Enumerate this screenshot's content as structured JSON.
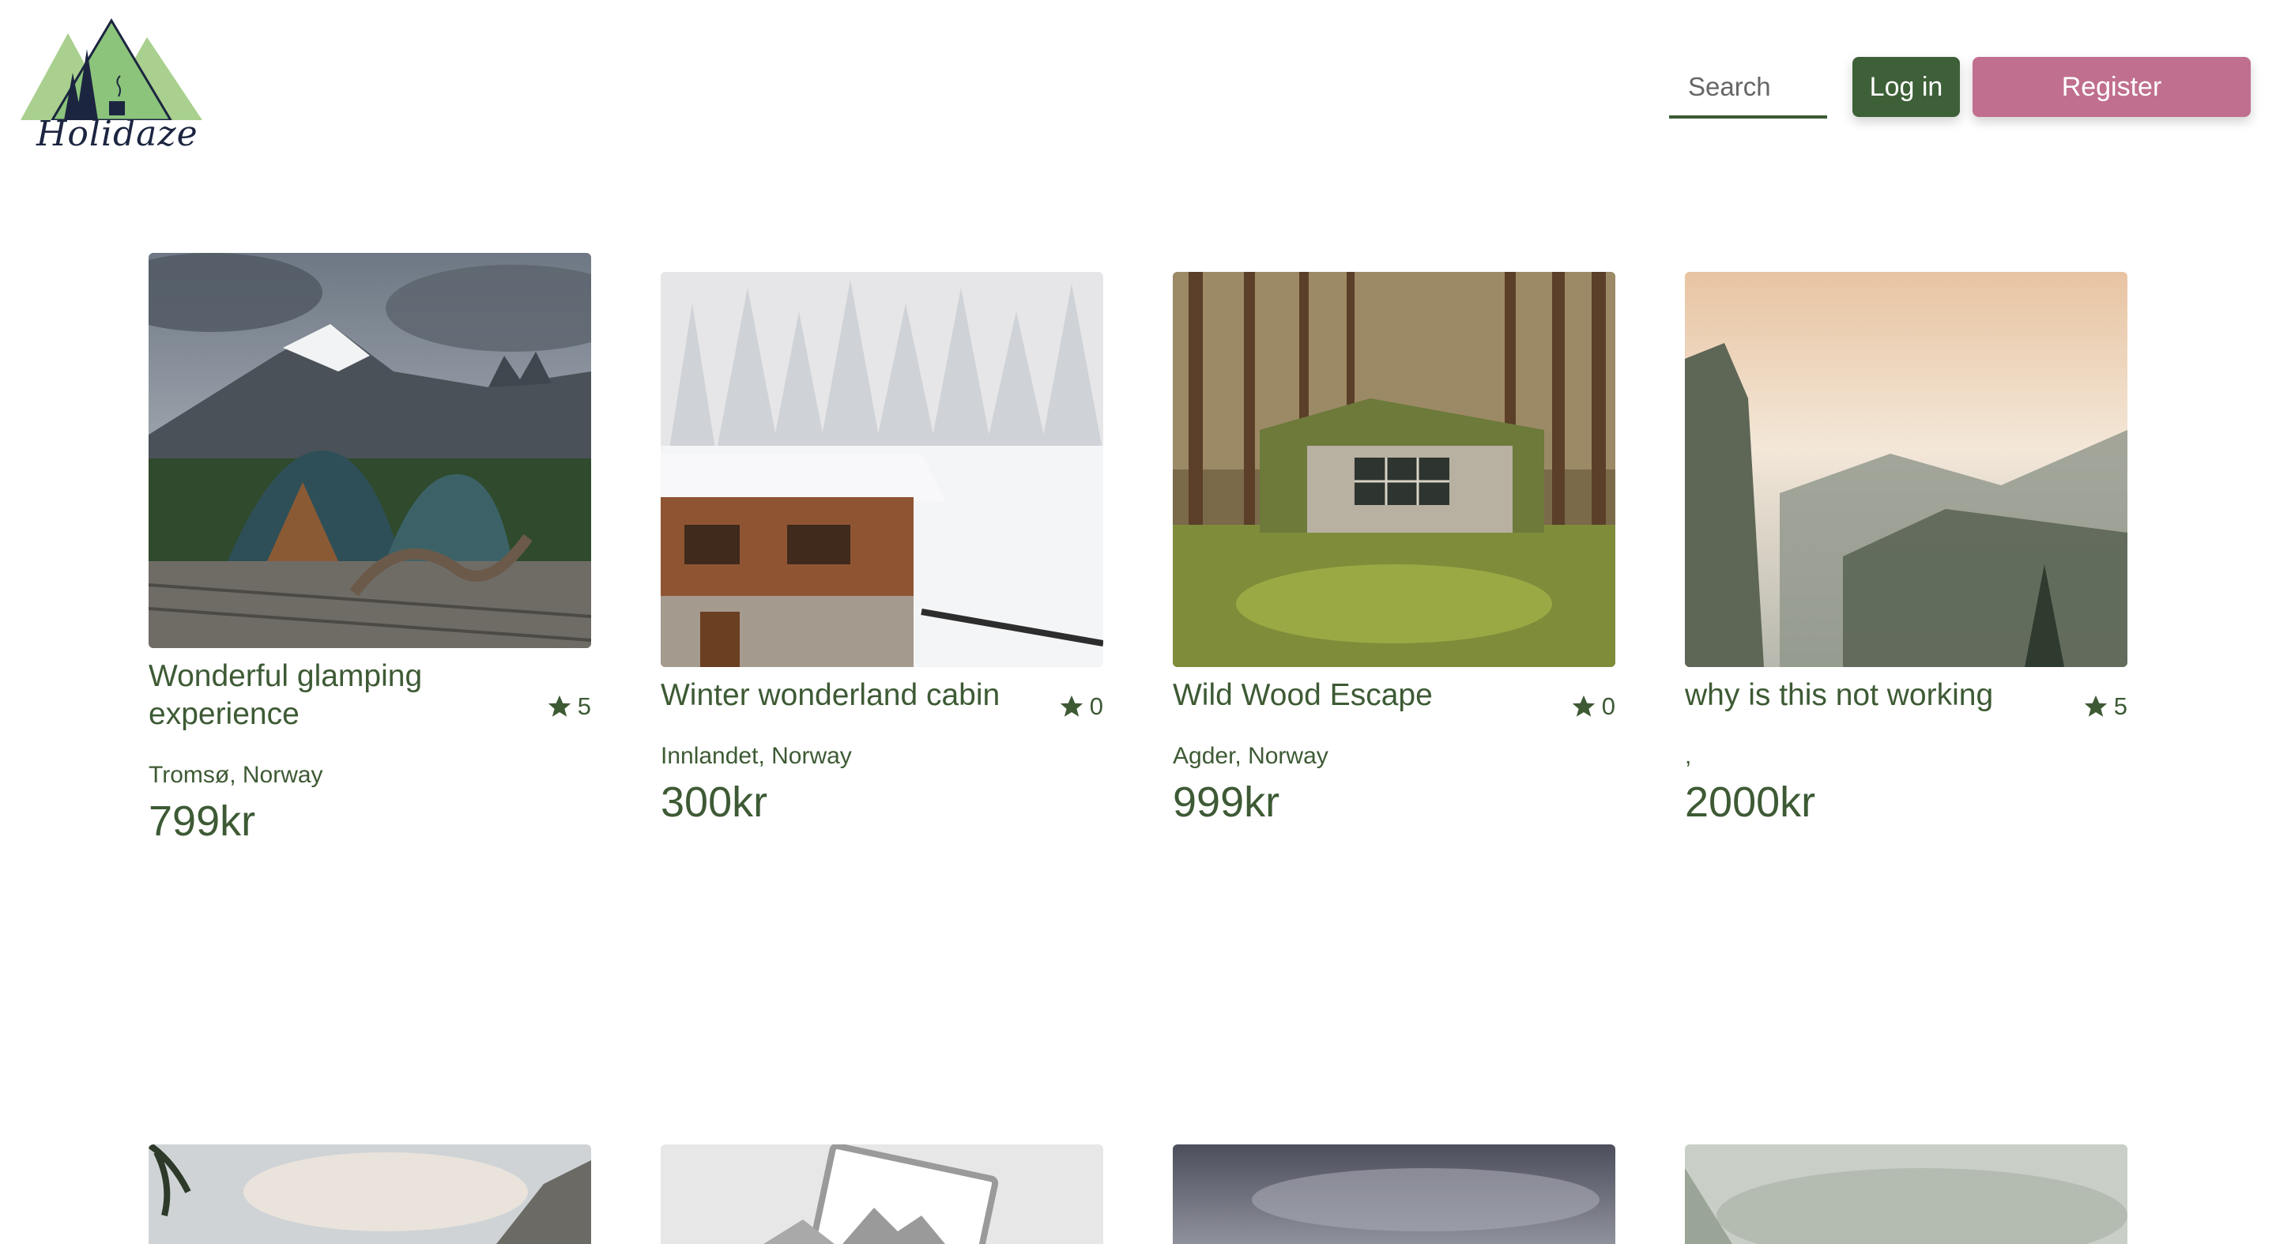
{
  "brand": {
    "name": "Holidaze"
  },
  "header": {
    "search": {
      "placeholder": "Search",
      "value": ""
    },
    "login_label": "Log in",
    "register_label": "Register"
  },
  "colors": {
    "primary_green": "#3e6038",
    "text_green": "#3d5a34",
    "register_pink": "#c06f8f"
  },
  "listings": [
    {
      "title": "Wonderful glamping experience",
      "rating": "5",
      "location": "Tromsø, Norway",
      "price": "799kr"
    },
    {
      "title": "Winter wonderland cabin",
      "rating": "0",
      "location": "Innlandet, Norway",
      "price": "300kr"
    },
    {
      "title": "Wild Wood Escape",
      "rating": "0",
      "location": "Agder, Norway",
      "price": "999kr"
    },
    {
      "title": "why is this not working",
      "rating": "5",
      "location": ",",
      "price": "2000kr"
    }
  ],
  "icons": {
    "rating": "star-icon",
    "placeholder_image": "image-placeholder-icon"
  }
}
